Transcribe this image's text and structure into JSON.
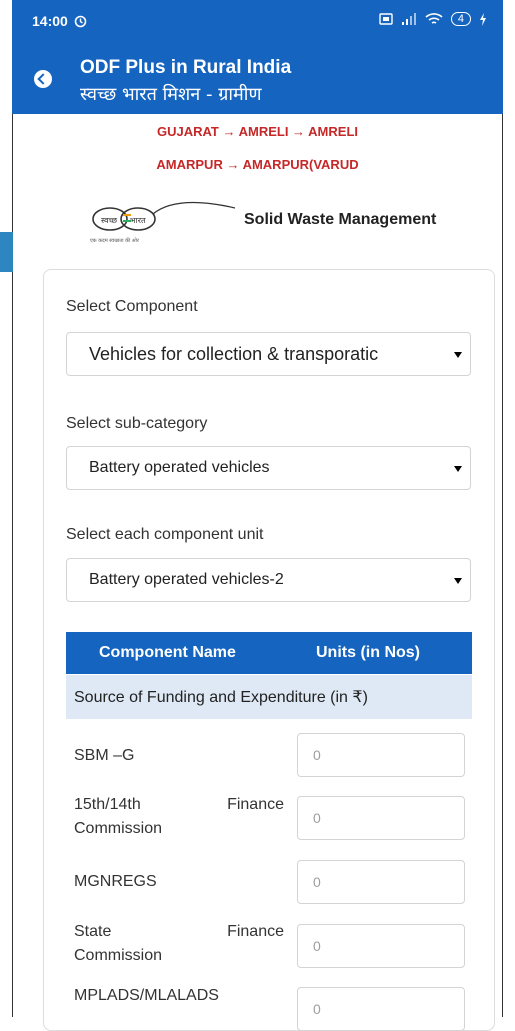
{
  "status_bar": {
    "time": "14:00",
    "battery": "4"
  },
  "app_bar": {
    "title": "ODF Plus in Rural India",
    "subtitle": "स्वच्छ भारत मिशन - ग्रामीण"
  },
  "breadcrumb": {
    "line1": "GUJARAT → AMRELI → AMRELI",
    "line2": "AMARPUR → AMARPUR(VARUD"
  },
  "logo": {
    "text_left": "स्वच्छ",
    "text_right": "भारत",
    "tagline": "एक कदम स्वच्छता की ओर"
  },
  "section_title": "Solid Waste Management",
  "form": {
    "component_label": "Select Component",
    "component_value": "Vehicles for collection & transporatic",
    "subcategory_label": "Select sub-category",
    "subcategory_value": "Battery operated vehicles",
    "unit_label": "Select each component unit",
    "unit_value": "Battery operated vehicles-2"
  },
  "table": {
    "col1": "Component Name",
    "col2": "Units (in Nos)",
    "subheader": "Source of Funding and Expenditure (in ₹)",
    "rows": [
      {
        "label": "SBM –G",
        "value": "0"
      },
      {
        "label_a": "15th/14th",
        "label_b": "Finance",
        "label_c": "Commission",
        "value": "0"
      },
      {
        "label": "MGNREGS",
        "value": "0"
      },
      {
        "label_a": "State",
        "label_b": "Finance",
        "label_c": "Commission",
        "value": "0"
      },
      {
        "label": "MPLADS/MLALADS",
        "value": "0"
      }
    ]
  },
  "colors": {
    "primary": "#1565c0",
    "breadcrumb": "#c62828",
    "subheader_bg": "#dfe9f5"
  }
}
